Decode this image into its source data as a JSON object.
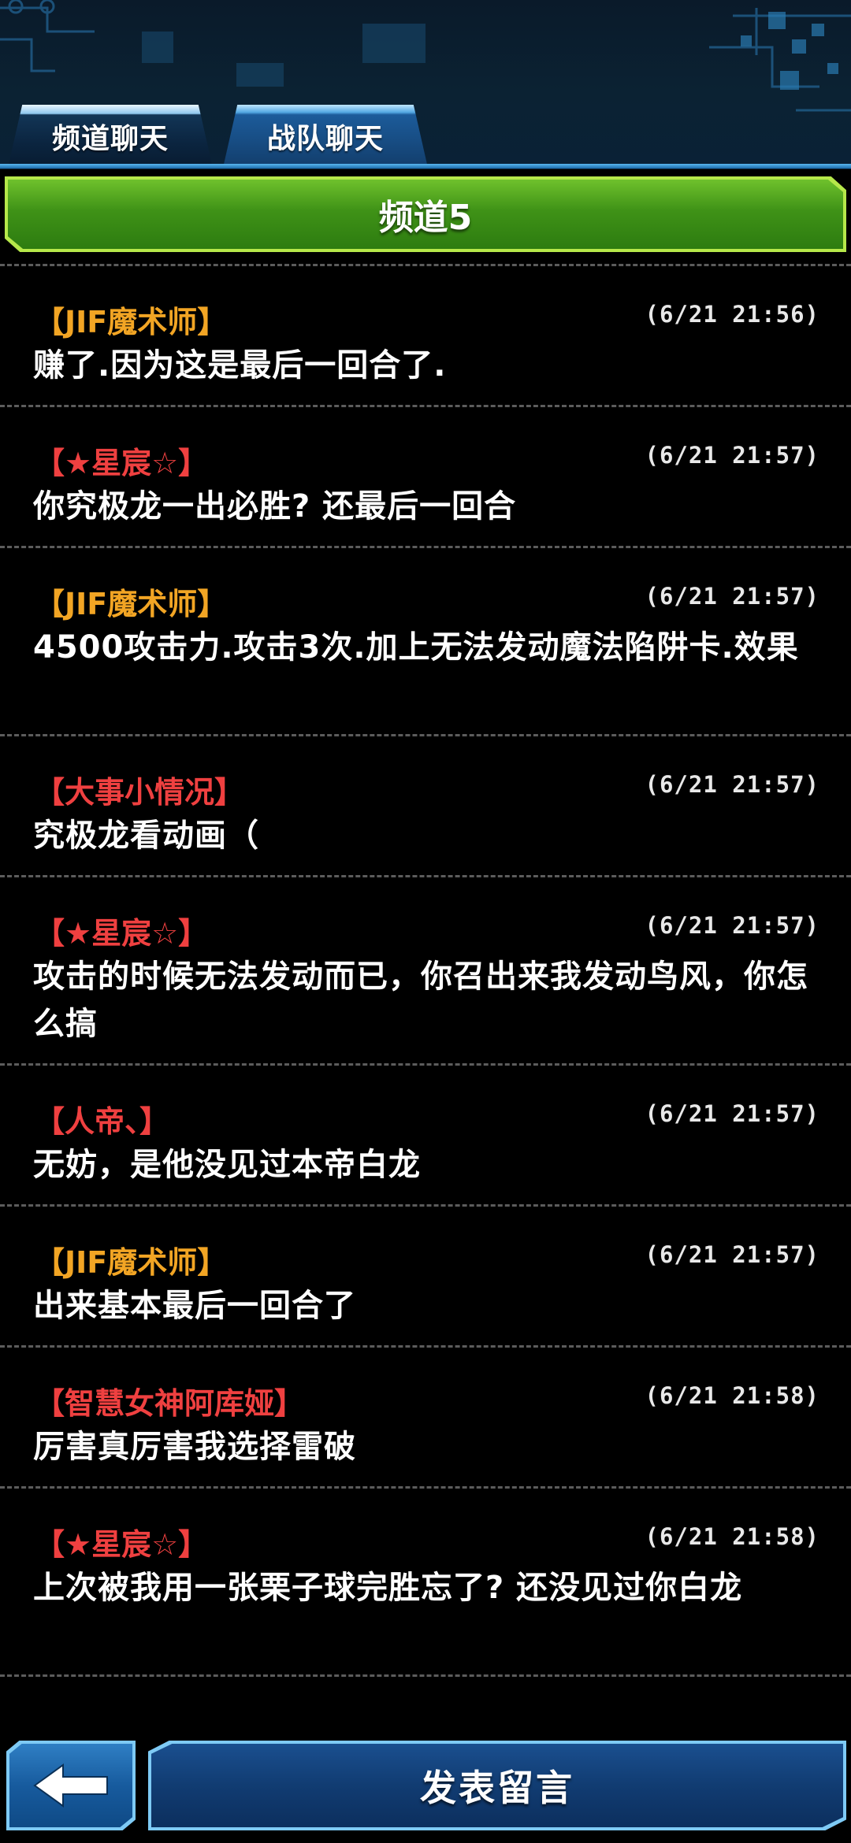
{
  "tabs": [
    {
      "label": "频道聊天",
      "active": true
    },
    {
      "label": "战队聊天",
      "active": false
    }
  ],
  "channel": {
    "title": "频道5"
  },
  "messages": [
    {
      "name": "【JIF魔术师】",
      "name_color": "orange",
      "time": "(6/21 21:56)",
      "text": "赚了.因为这是最后一回合了."
    },
    {
      "name": "【★星宸☆】",
      "name_color": "red",
      "time": "(6/21 21:57)",
      "text": "你究极龙一出必胜? 还最后一回合"
    },
    {
      "name": "【JIF魔术师】",
      "name_color": "orange",
      "time": "(6/21 21:57)",
      "text": "4500攻击力.攻击3次.加上无法发动魔法陷阱卡.效果"
    },
    {
      "name": "【大事小情况】",
      "name_color": "red",
      "time": "(6/21 21:57)",
      "text": "究极龙看动画（"
    },
    {
      "name": "【★星宸☆】",
      "name_color": "red",
      "time": "(6/21 21:57)",
      "text": "攻击的时候无法发动而已，你召出来我发动鸟风，你怎么搞"
    },
    {
      "name": "【人帝、】",
      "name_color": "red",
      "time": "(6/21 21:57)",
      "text": "无妨，是他没见过本帝白龙"
    },
    {
      "name": "【JIF魔术师】",
      "name_color": "orange",
      "time": "(6/21 21:57)",
      "text": "出来基本最后一回合了"
    },
    {
      "name": "【智慧女神阿库娅】",
      "name_color": "red",
      "time": "(6/21 21:58)",
      "text": "厉害真厉害我选择雷破"
    },
    {
      "name": "【★星宸☆】",
      "name_color": "red",
      "time": "(6/21 21:58)",
      "text": "上次被我用一张栗子球完胜忘了? 还没见过你白龙"
    }
  ],
  "colors": {
    "orange": "#f2a524",
    "red": "#ef4040",
    "header_green": "#3f9217",
    "button_blue": "#113c72"
  },
  "bottom": {
    "back_icon": "back-arrow-icon",
    "post_label": "发表留言"
  }
}
